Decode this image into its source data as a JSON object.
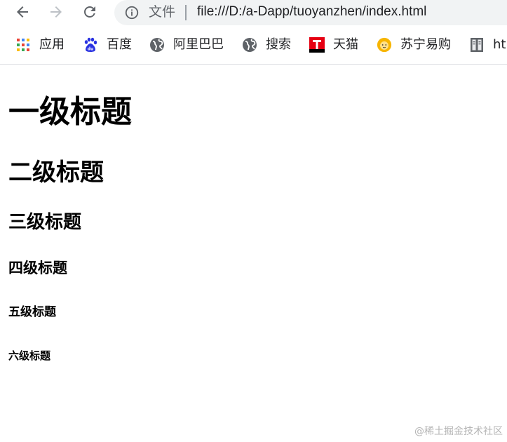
{
  "toolbar": {
    "scheme_label": "文件",
    "url": "file:///D:/a-Dapp/tuoyanzhen/index.html"
  },
  "bookmarks": [
    {
      "label": "应用",
      "icon": "apps-grid-icon"
    },
    {
      "label": "百度",
      "icon": "baidu-paw-icon"
    },
    {
      "label": "阿里巴巴",
      "icon": "globe-icon"
    },
    {
      "label": "搜索",
      "icon": "globe-icon"
    },
    {
      "label": "天猫",
      "icon": "tmall-icon"
    },
    {
      "label": "苏宁易购",
      "icon": "suning-lion-icon"
    },
    {
      "label": "ht",
      "icon": "bookmark-page-icon"
    }
  ],
  "page": {
    "h1": "一级标题",
    "h2": "二级标题",
    "h3": "三级标题",
    "h4": "四级标题",
    "h5": "五级标题",
    "h6": "六级标题"
  },
  "watermark": "@稀土掘金技术社区",
  "colors": {
    "omnibox_bg": "#f1f3f4",
    "icon_gray": "#5f6368",
    "baidu_blue": "#2932e1",
    "tmall_red": "#e60012",
    "suning_yellow": "#f7b500"
  }
}
